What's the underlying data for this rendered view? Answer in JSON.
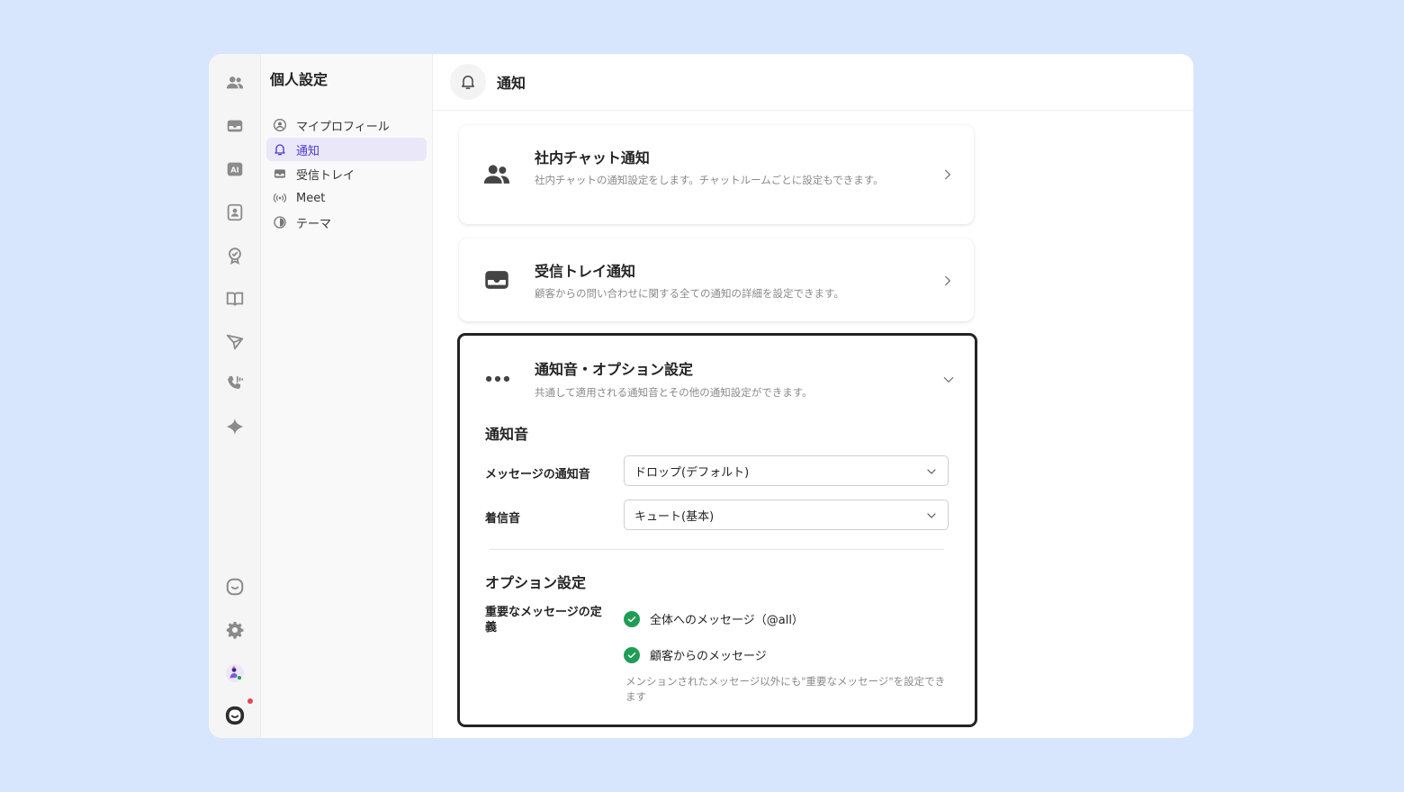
{
  "settings_nav": {
    "title": "個人設定",
    "items": [
      {
        "label": "マイプロフィール",
        "icon": "user-circle-icon"
      },
      {
        "label": "通知",
        "icon": "bell-icon"
      },
      {
        "label": "受信トレイ",
        "icon": "inbox-icon"
      },
      {
        "label": "Meet",
        "icon": "broadcast-icon"
      },
      {
        "label": "テーマ",
        "icon": "contrast-icon"
      }
    ]
  },
  "header": {
    "title": "通知",
    "icon": "bell-icon"
  },
  "cards": {
    "chat": {
      "title": "社内チャット通知",
      "desc": "社内チャットの通知設定をします。チャットルームごとに設定もできます。"
    },
    "inbox": {
      "title": "受信トレイ通知",
      "desc": "顧客からの問い合わせに関する全ての通知の詳細を設定できます。"
    },
    "sound": {
      "title": "通知音・オプション設定",
      "desc": "共通して適用される通知音とその他の通知設定ができます。"
    }
  },
  "sound_section": {
    "title": "通知音",
    "message_label": "メッセージの通知音",
    "message_value": "ドロップ(デフォルト)",
    "ring_label": "着信音",
    "ring_value": "キュート(基本)"
  },
  "option_section": {
    "title": "オプション設定",
    "important_label": "重要なメッセージの定義",
    "check_all": "全体へのメッセージ（@all）",
    "check_customer": "顧客からのメッセージ",
    "help": "メンションされたメッセージ以外にも\"重要なメッセージ\"を設定できます"
  },
  "colors": {
    "accent": "#4b3ad0",
    "active_bg": "#e9e7f8",
    "check": "#1f9d55",
    "page_bg": "#d8e6fd",
    "notify_dot": "#e5484d"
  }
}
